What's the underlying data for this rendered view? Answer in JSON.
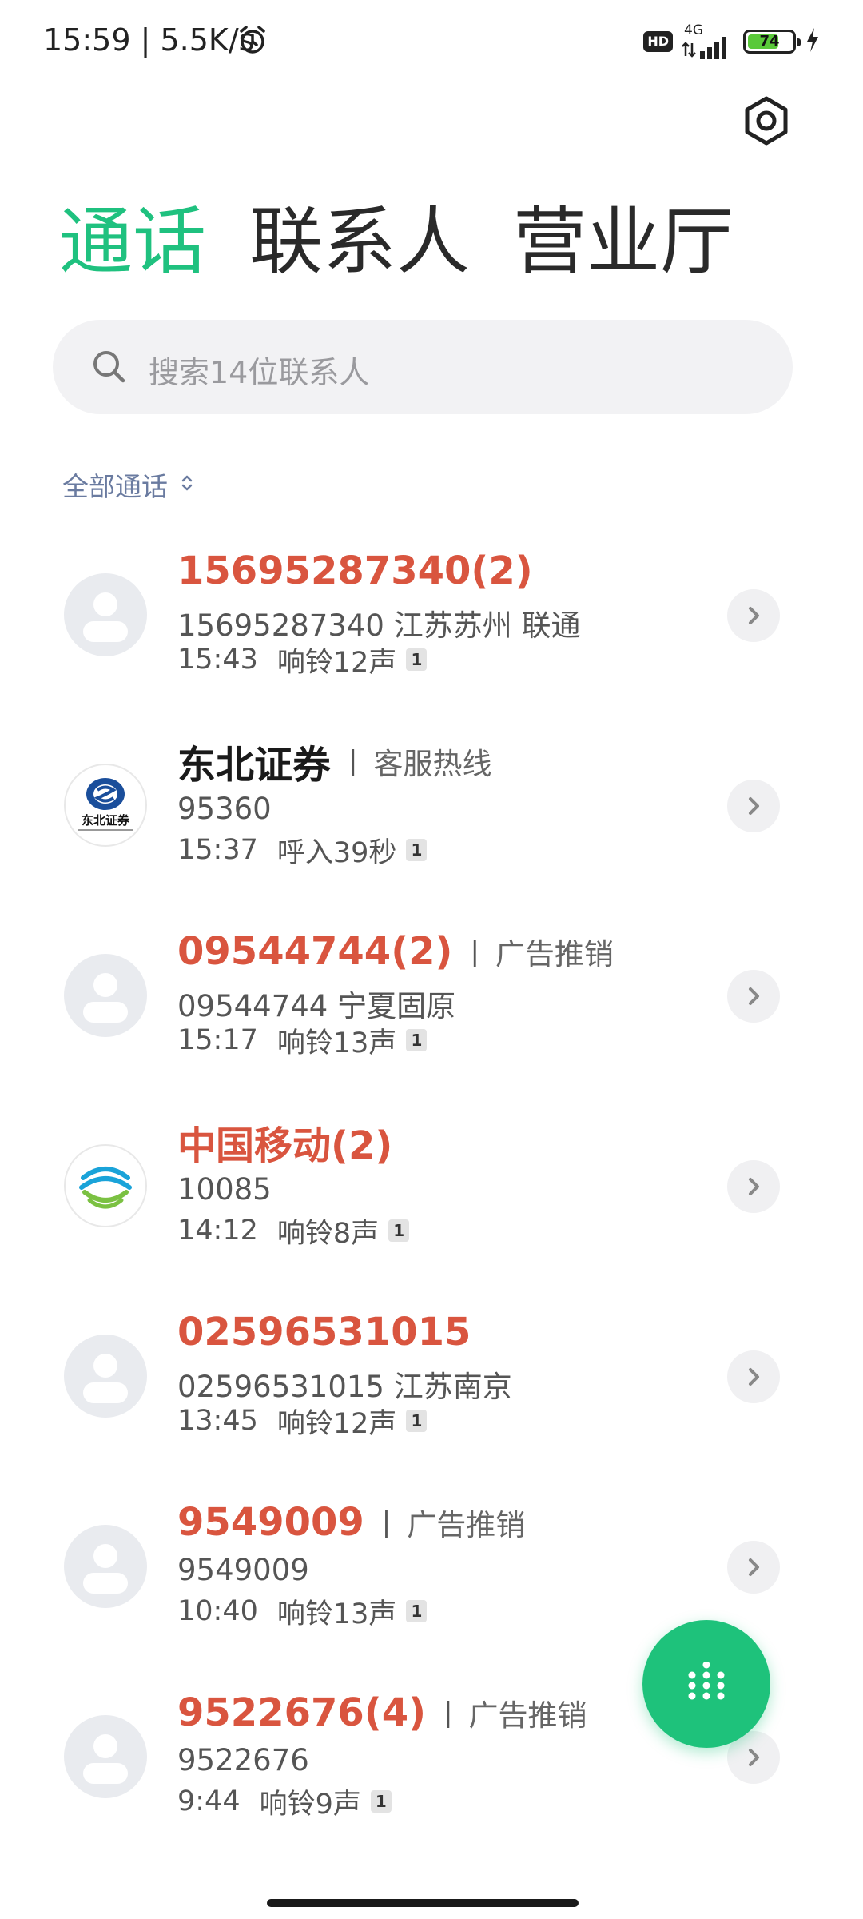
{
  "status_bar": {
    "time": "15:59 | 5.5K/s",
    "hd": "HD",
    "network": "4G",
    "battery": "74",
    "battery_level": 0.74
  },
  "tabs": [
    {
      "label": "通话",
      "active": true
    },
    {
      "label": "联系人",
      "active": false
    },
    {
      "label": "营业厅",
      "active": false
    }
  ],
  "search": {
    "placeholder": "搜索14位联系人"
  },
  "filter": {
    "label": "全部通话"
  },
  "calls": [
    {
      "name": "15695287340(2)",
      "tag": "",
      "number": "15695287340 江苏苏州 联通",
      "time": "15:43",
      "duration": "响铃12声",
      "sim": "1",
      "avatar": "default-avatar-icon",
      "missed": true
    },
    {
      "name": "东北证券",
      "tag": "客服热线",
      "number": "95360",
      "time": "15:37",
      "duration": "呼入39秒",
      "sim": "1",
      "avatar": "northeast-securities-logo",
      "missed": false
    },
    {
      "name": "09544744(2)",
      "tag": "广告推销",
      "number": "09544744 宁夏固原",
      "time": "15:17",
      "duration": "响铃13声",
      "sim": "1",
      "avatar": "default-avatar-icon",
      "missed": true
    },
    {
      "name": "中国移动(2)",
      "tag": "",
      "number": "10085",
      "time": "14:12",
      "duration": "响铃8声",
      "sim": "1",
      "avatar": "china-mobile-logo",
      "missed": true
    },
    {
      "name": "02596531015",
      "tag": "",
      "number": "02596531015 江苏南京",
      "time": "13:45",
      "duration": "响铃12声",
      "sim": "1",
      "avatar": "default-avatar-icon",
      "missed": true
    },
    {
      "name": "9549009",
      "tag": "广告推销",
      "number": "9549009",
      "time": "10:40",
      "duration": "响铃13声",
      "sim": "1",
      "avatar": "default-avatar-icon",
      "missed": true
    },
    {
      "name": "9522676(4)",
      "tag": "广告推销",
      "number": "9522676",
      "time": "9:44",
      "duration": "响铃9声",
      "sim": "1",
      "avatar": "default-avatar-icon",
      "missed": true
    }
  ],
  "colors": {
    "accent": "#1fc17f",
    "missed": "#d9553f",
    "fab": "#1ec27b"
  },
  "icons": {
    "settings": "settings-hex-icon",
    "search": "search-icon",
    "fab": "dialpad-icon",
    "chevron": "chevron-right-icon"
  }
}
